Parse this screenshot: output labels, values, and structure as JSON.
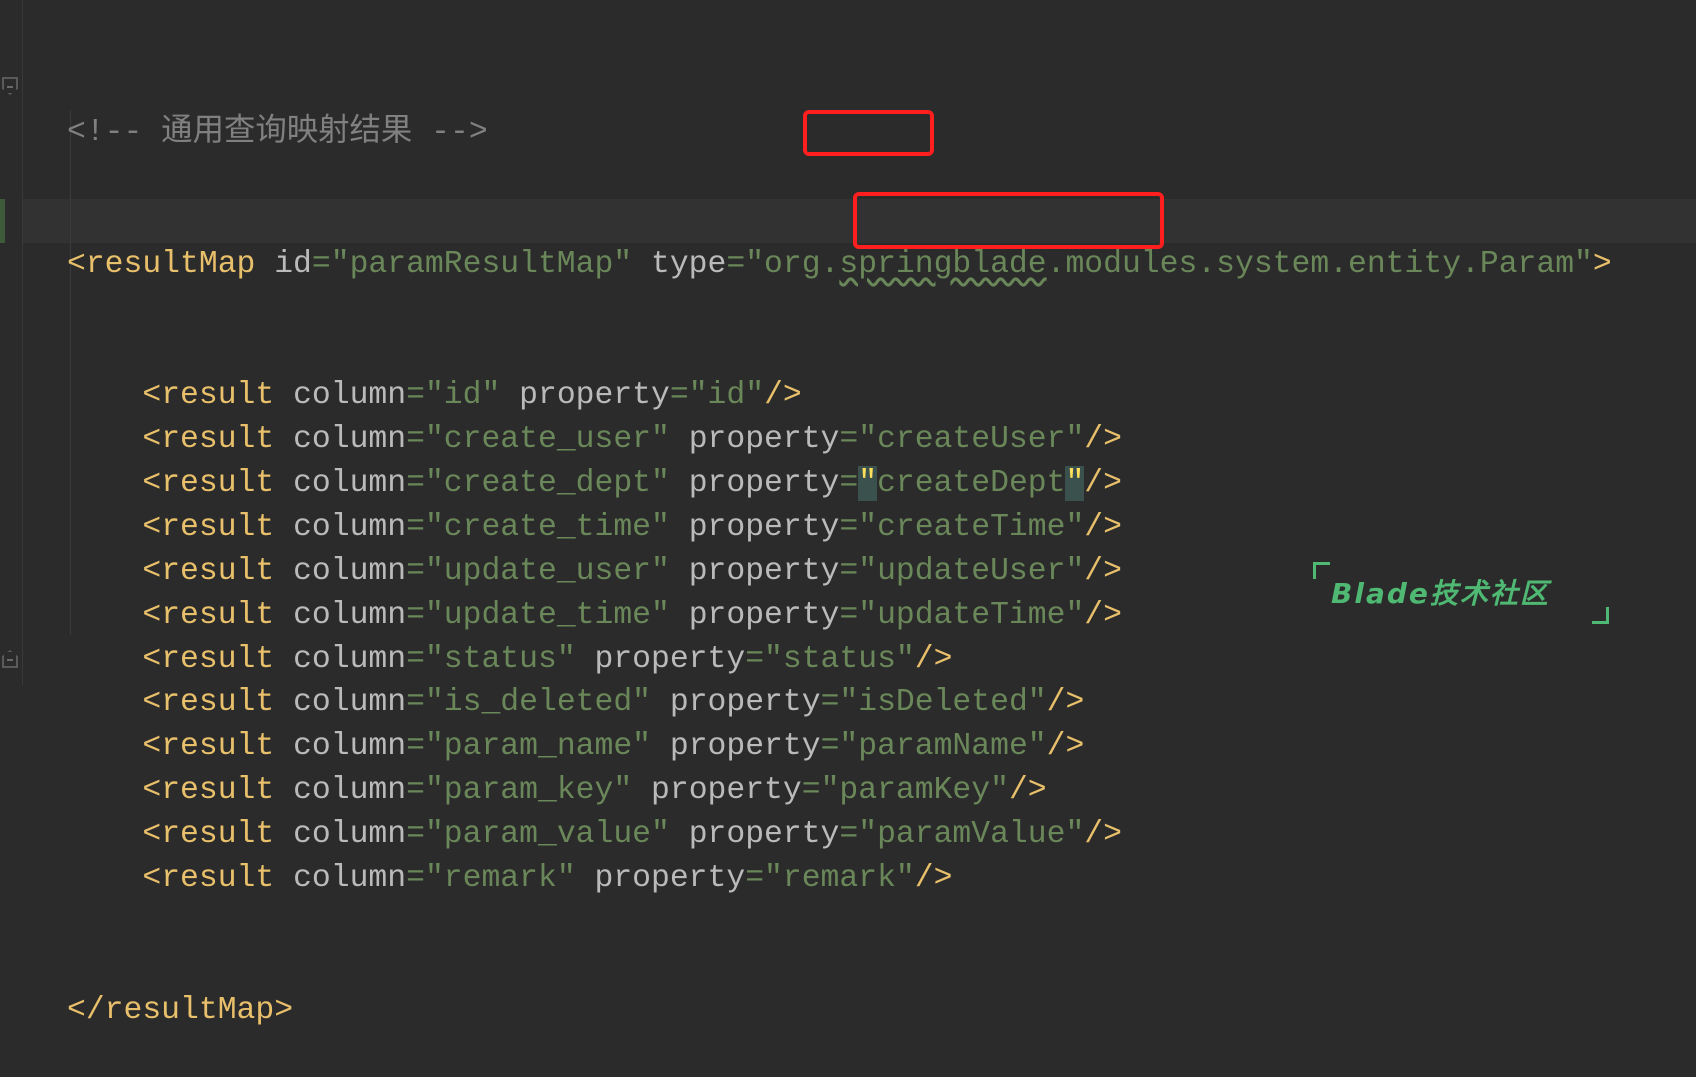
{
  "editor": {
    "comment": "<!-- 通用查询映射结果 -->",
    "resultMap": {
      "open_tag": "<resultMap",
      "id_attr": "id",
      "id_value": "\"paramResultMap\"",
      "type_attr": "type",
      "type_value_prefix": "\"org.",
      "type_value_wavy": "springblade",
      "type_value_suffix": ".modules.system.entity.Param\"",
      "close_bracket": ">",
      "close_tag": "</resultMap>"
    },
    "results": [
      {
        "column": "\"id\"",
        "property": "\"id\""
      },
      {
        "column": "\"create_user\"",
        "property": "\"createUser\""
      },
      {
        "column": "\"create_dept\"",
        "property": "createDept"
      },
      {
        "column": "\"create_time\"",
        "property": "\"createTime\""
      },
      {
        "column": "\"update_user\"",
        "property": "\"updateUser\""
      },
      {
        "column": "\"update_time\"",
        "property": "\"updateTime\""
      },
      {
        "column": "\"status\"",
        "property": "\"status\""
      },
      {
        "column": "\"is_deleted\"",
        "property": "\"isDeleted\""
      },
      {
        "column": "\"param_name\"",
        "property": "\"paramName\""
      },
      {
        "column": "\"param_key\"",
        "property": "\"paramKey\""
      },
      {
        "column": "\"param_value\"",
        "property": "\"paramValue\""
      },
      {
        "column": "\"remark\"",
        "property": "\"remark\""
      }
    ],
    "tokens": {
      "result_tag": "<result",
      "column_attr": "column",
      "property_attr": "property",
      "eq": "=",
      "self_close": "/>",
      "quote": "\""
    }
  },
  "watermark": {
    "text": "Blade技术社区"
  },
  "colors": {
    "background": "#2b2b2b",
    "tag": "#e8bf6a",
    "attribute": "#bababa",
    "string": "#6a8759",
    "comment": "#808080",
    "annotation_box": "#ff1f1f",
    "watermark": "#4fb872"
  }
}
